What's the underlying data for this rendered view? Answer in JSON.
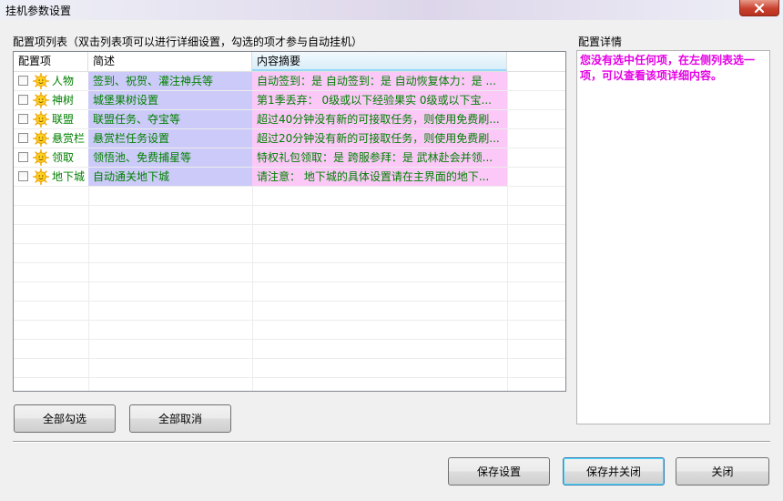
{
  "window": {
    "title": "挂机参数设置"
  },
  "list": {
    "group_label": "配置项列表（双击列表项可以进行详细设置，勾选的项才参与自动挂机）",
    "columns": [
      "配置项",
      "简述",
      "内容摘要"
    ],
    "rows": [
      {
        "name": "人物",
        "summary": "签到、祝贺、灌注神兵等",
        "content": "自动签到：是  自动签到：是  自动恢复体力：是 ..."
      },
      {
        "name": "神树",
        "summary": "城堡果树设置",
        "content": "第1季丢弃：  0级或以下经验果实  0级或以下宝..."
      },
      {
        "name": "联盟",
        "summary": "联盟任务、夺宝等",
        "content": "超过40分钟没有新的可接取任务，则使用免费刷..."
      },
      {
        "name": "悬赏栏",
        "summary": "悬赏栏任务设置",
        "content": "超过20分钟没有新的可接取任务，则使用免费刷..."
      },
      {
        "name": "领取",
        "summary": "领悟池、免费捕星等",
        "content": "特权礼包领取：是  跨服参拜：是  武林赴会并领..."
      },
      {
        "name": "地下城",
        "summary": "自动通关地下城",
        "content": "请注意：  地下城的具体设置请在主界面的地下..."
      }
    ]
  },
  "detail": {
    "label": "配置详情",
    "text": "您没有选中任何项，在左侧列表选一项，可以查看该项详细内容。"
  },
  "buttons": {
    "select_all": "全部勾选",
    "deselect_all": "全部取消",
    "save": "保存设置",
    "save_close": "保存并关闭",
    "close": "关闭"
  },
  "colors": {
    "summary_bg": "#cccaf8",
    "content_bg": "#fbc8f8",
    "row_text": "#008000",
    "detail_text": "#e400e4"
  }
}
